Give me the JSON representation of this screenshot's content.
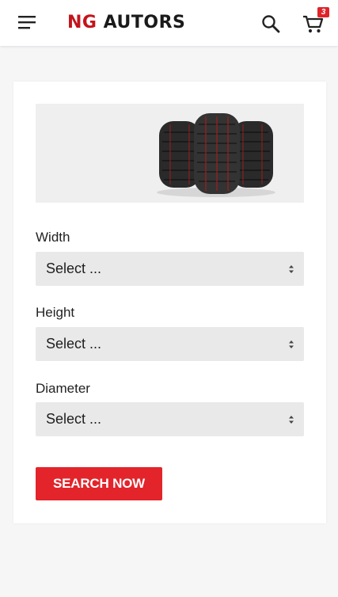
{
  "header": {
    "logo_part1": "NG",
    "logo_part2": "AUTORS",
    "cart_count": "3",
    "brand_color": "#c3141c"
  },
  "finder": {
    "fields": [
      {
        "label": "Width",
        "value": "Select ..."
      },
      {
        "label": "Height",
        "value": "Select ..."
      },
      {
        "label": "Diameter",
        "value": "Select ..."
      }
    ],
    "submit_label": "SEARCH NOW",
    "accent_color": "#e3242b"
  },
  "icons": [
    "menu-icon",
    "search-icon",
    "cart-icon",
    "tire-image"
  ]
}
